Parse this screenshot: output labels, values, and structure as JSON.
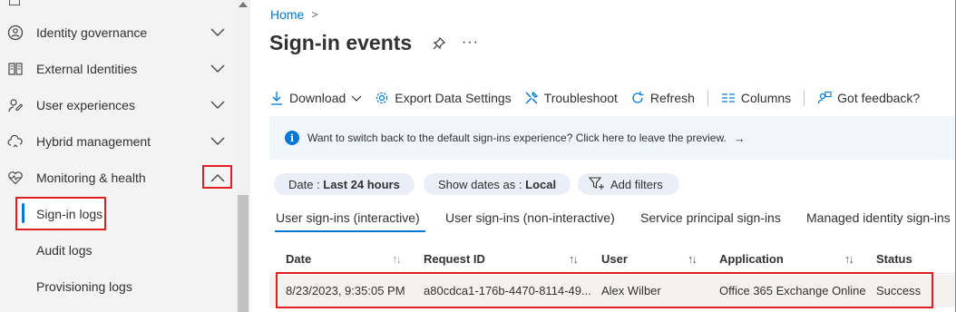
{
  "sidebar": {
    "items": [
      {
        "label": "Identity governance",
        "icon": "identity-governance-icon"
      },
      {
        "label": "External Identities",
        "icon": "external-identities-icon"
      },
      {
        "label": "User experiences",
        "icon": "user-experiences-icon"
      },
      {
        "label": "Hybrid management",
        "icon": "hybrid-management-icon"
      },
      {
        "label": "Monitoring & health",
        "icon": "heart-monitor-icon"
      }
    ],
    "subitems": [
      {
        "label": "Sign-in logs",
        "selected": true
      },
      {
        "label": "Audit logs"
      },
      {
        "label": "Provisioning logs"
      }
    ]
  },
  "breadcrumb": {
    "home": "Home",
    "separator": ">"
  },
  "page": {
    "title": "Sign-in events",
    "more": "···"
  },
  "toolbar": {
    "download": "Download",
    "export": "Export Data Settings",
    "troubleshoot": "Troubleshoot",
    "refresh": "Refresh",
    "columns": "Columns",
    "feedback": "Got feedback?"
  },
  "banner": {
    "text": "Want to switch back to the default sign-ins experience? Click here to leave the preview.",
    "arrow": "→"
  },
  "filters": {
    "date_label": "Date : ",
    "date_value": "Last 24 hours",
    "tz_label": "Show dates as : ",
    "tz_value": "Local",
    "add": "Add filters"
  },
  "tabs": [
    {
      "label": "User sign-ins (interactive)",
      "active": true
    },
    {
      "label": "User sign-ins (non-interactive)"
    },
    {
      "label": "Service principal sign-ins"
    },
    {
      "label": "Managed identity sign-ins"
    }
  ],
  "table": {
    "columns": [
      "Date",
      "Request ID",
      "User",
      "Application",
      "Status"
    ],
    "sort_icon": "↑↓",
    "rows": [
      {
        "date": "8/23/2023, 9:35:05 PM",
        "request_id": "a80cdca1-176b-4470-8114-49...",
        "user": "Alex Wilber",
        "application": "Office 365 Exchange Online",
        "status": "Success"
      }
    ]
  },
  "colors": {
    "accent": "#0078d4",
    "highlight": "#e02020",
    "banner_bg": "#eff6fc"
  }
}
